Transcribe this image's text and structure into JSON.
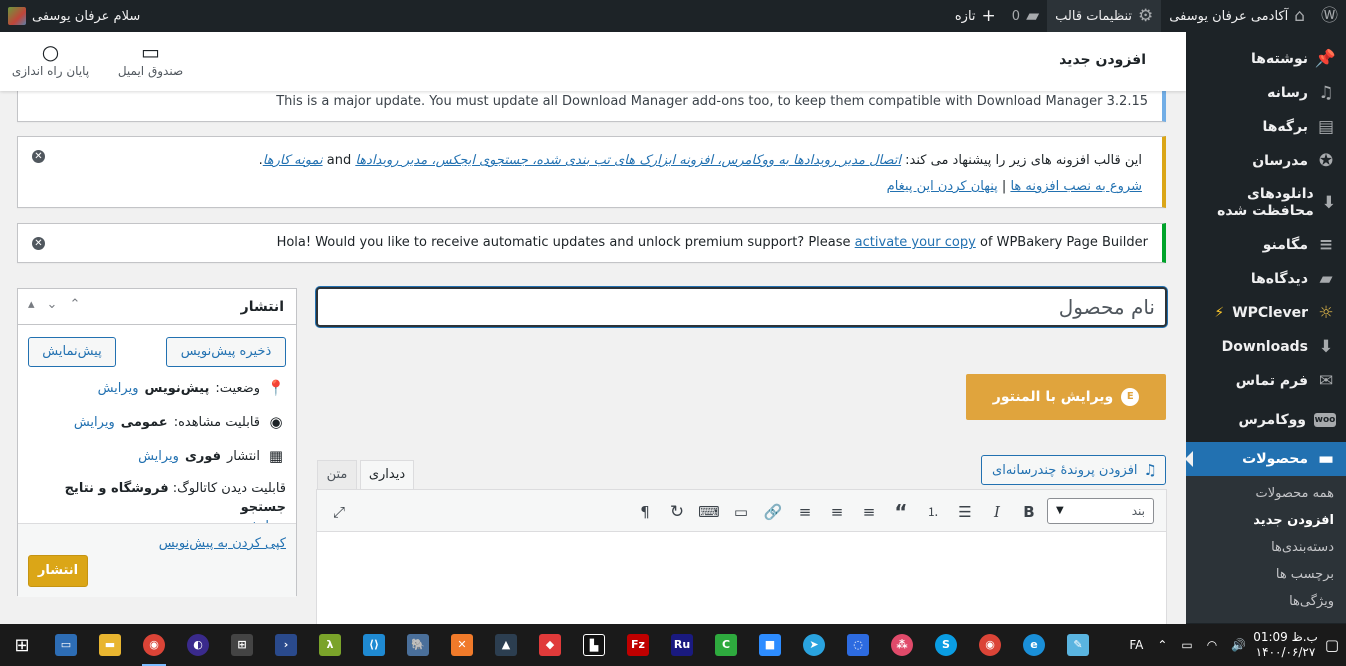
{
  "adminbar": {
    "site_name": "آکادمی عرفان یوسفی",
    "theme_settings": "تنظیمات قالب",
    "comments_count": "0",
    "new_label": "تازه",
    "greeting": "سلام عرفان یوسفی"
  },
  "menu": {
    "items": [
      {
        "label": "نوشته‌ها",
        "icon": "pin-icon"
      },
      {
        "label": "رسانه",
        "icon": "media-icon"
      },
      {
        "label": "برگه‌ها",
        "icon": "pages-icon"
      },
      {
        "label": "مدرسان",
        "icon": "award-icon"
      },
      {
        "label": "دانلودهای محافظت شده",
        "icon": "download-icon"
      },
      {
        "label": "مگامنو",
        "icon": "menu-icon"
      },
      {
        "label": "دیدگاه‌ها",
        "icon": "comment-icon"
      },
      {
        "label": "WPClever",
        "icon": "bolt-icon"
      },
      {
        "label": "Downloads",
        "icon": "download-icon"
      },
      {
        "label": "فرم تماس",
        "icon": "mail-icon"
      },
      {
        "label": "ووکامرس",
        "icon": "woo-icon"
      },
      {
        "label": "محصولات",
        "icon": "products-icon"
      }
    ],
    "submenu": [
      "همه محصولات",
      "افزودن جدید",
      "دسته‌بندی‌ها",
      "برچسب ها",
      "ویژگی‌ها"
    ]
  },
  "header": {
    "title": "افزودن جدید",
    "inbox_label": "صندوق ایمیل",
    "finish_setup_label": "پایان راه اندازی"
  },
  "notices": {
    "update_text": "This is a major update. You must update all Download Manager add-ons too, to keep them compatible with Download Manager 3.2.15",
    "theme_prefix": "این قالب افزونه های زیر را پیشنهاد می کند:",
    "theme_plugins": "اتصال مدیر رویدادها به ووکامرس، افزونه ابزارک های تب بندی شده، جستجوی ایجکس، مدیر رویدادها",
    "theme_and": "and",
    "theme_last": "نمونه کارها",
    "install_link": "شروع به نصب افزونه ها",
    "separator": "|",
    "hide_link": "پنهان کردن این پیغام",
    "wpb_prefix": "Hola! Would you like to receive automatic updates and unlock premium support? Please",
    "wpb_link": "activate your copy",
    "wpb_suffix": "of WPBakery Page Builder"
  },
  "publish": {
    "title": "انتشار",
    "save_draft": "ذخیره پیش‌نویس",
    "preview": "پیش‌نمایش",
    "status_label": "وضعیت:",
    "status_value": "پیش‌نویس",
    "visibility_label": "قابلیت مشاهده:",
    "visibility_value": "عمومی",
    "publish_time_label": "انتشار",
    "publish_time_value": "فوری",
    "catalog_label": "قابلیت دیدن کاتالوگ:",
    "catalog_value": "فروشگاه و نتایج جستجو",
    "edit_link": "ویرایش",
    "copy_draft": "کپی کردن به پیش‌نویس",
    "publish_button": "انتشار"
  },
  "editor": {
    "title_placeholder": "نام محصول",
    "elementor_button": "ویرایش با المنتور",
    "add_media": "افزودن پروندهٔ چندرسانه‌ای",
    "tab_visual": "دیداری",
    "tab_text": "متن",
    "format_value": "بند"
  },
  "taskbar": {
    "language": "FA",
    "time": "ب.ظ 01:09",
    "date": "۱۴۰۰/۰۶/۲۷"
  },
  "colors": {
    "accent": "#2271b1",
    "admin_bg": "#1d2327",
    "elementor": "#e0a43d",
    "publish_button": "#dba617"
  }
}
